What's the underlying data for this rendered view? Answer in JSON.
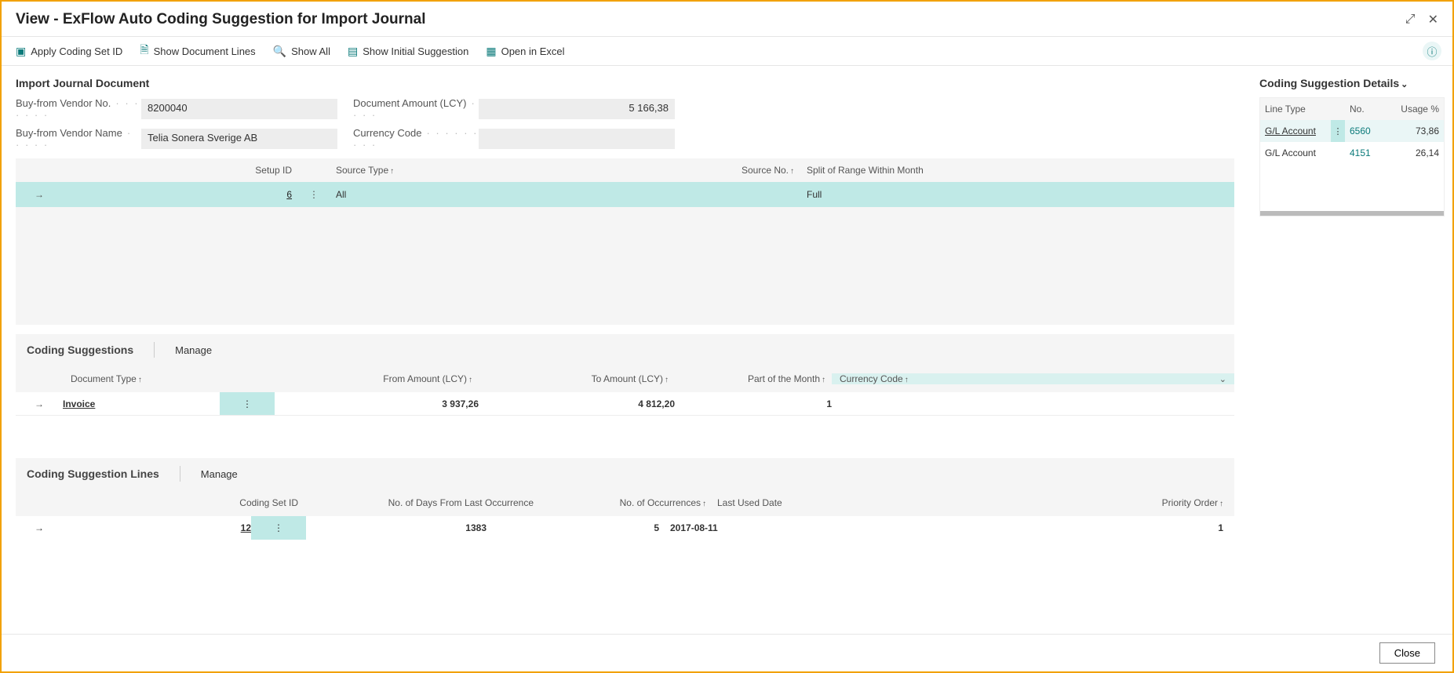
{
  "title": "View - ExFlow Auto Coding Suggestion for Import Journal",
  "toolbar": {
    "apply": "Apply Coding Set ID",
    "show_lines": "Show Document Lines",
    "show_all": "Show All",
    "show_initial": "Show Initial Suggestion",
    "open_excel": "Open in Excel"
  },
  "import_doc": {
    "heading": "Import Journal Document",
    "vendor_no_label": "Buy-from Vendor No.",
    "vendor_no": "8200040",
    "vendor_name_label": "Buy-from Vendor Name",
    "vendor_name": "Telia Sonera Sverige AB",
    "amount_label": "Document Amount (LCY)",
    "amount": "5 166,38",
    "currency_label": "Currency Code",
    "currency": ""
  },
  "grid1": {
    "headers": {
      "setup": "Setup ID",
      "source_type": "Source Type",
      "source_no": "Source No.",
      "split": "Split of Range Within Month"
    },
    "row": {
      "setup": "6",
      "source_type": "All",
      "source_no": "",
      "split": "Full"
    }
  },
  "coding_suggestions": {
    "title": "Coding Suggestions",
    "manage": "Manage",
    "headers": {
      "doc_type": "Document Type",
      "from": "From Amount (LCY)",
      "to": "To Amount (LCY)",
      "part": "Part of the Month",
      "currency": "Currency Code"
    },
    "row": {
      "doc_type": "Invoice",
      "from": "3 937,26",
      "to": "4 812,20",
      "part": "1",
      "currency": ""
    }
  },
  "coding_lines": {
    "title": "Coding Suggestion Lines",
    "manage": "Manage",
    "headers": {
      "set_id": "Coding Set ID",
      "days": "No. of Days From Last Occurrence",
      "occ": "No. of Occurrences",
      "last": "Last Used Date",
      "priority": "Priority Order"
    },
    "row": {
      "set_id": "12",
      "days": "1383",
      "occ": "5",
      "last": "2017-08-11",
      "priority": "1"
    }
  },
  "details": {
    "title": "Coding Suggestion Details",
    "headers": {
      "line_type": "Line Type",
      "no": "No.",
      "usage": "Usage %"
    },
    "rows": [
      {
        "line_type": "G/L Account",
        "no": "6560",
        "usage": "73,86"
      },
      {
        "line_type": "G/L Account",
        "no": "4151",
        "usage": "26,14"
      }
    ]
  },
  "footer": {
    "close": "Close"
  }
}
